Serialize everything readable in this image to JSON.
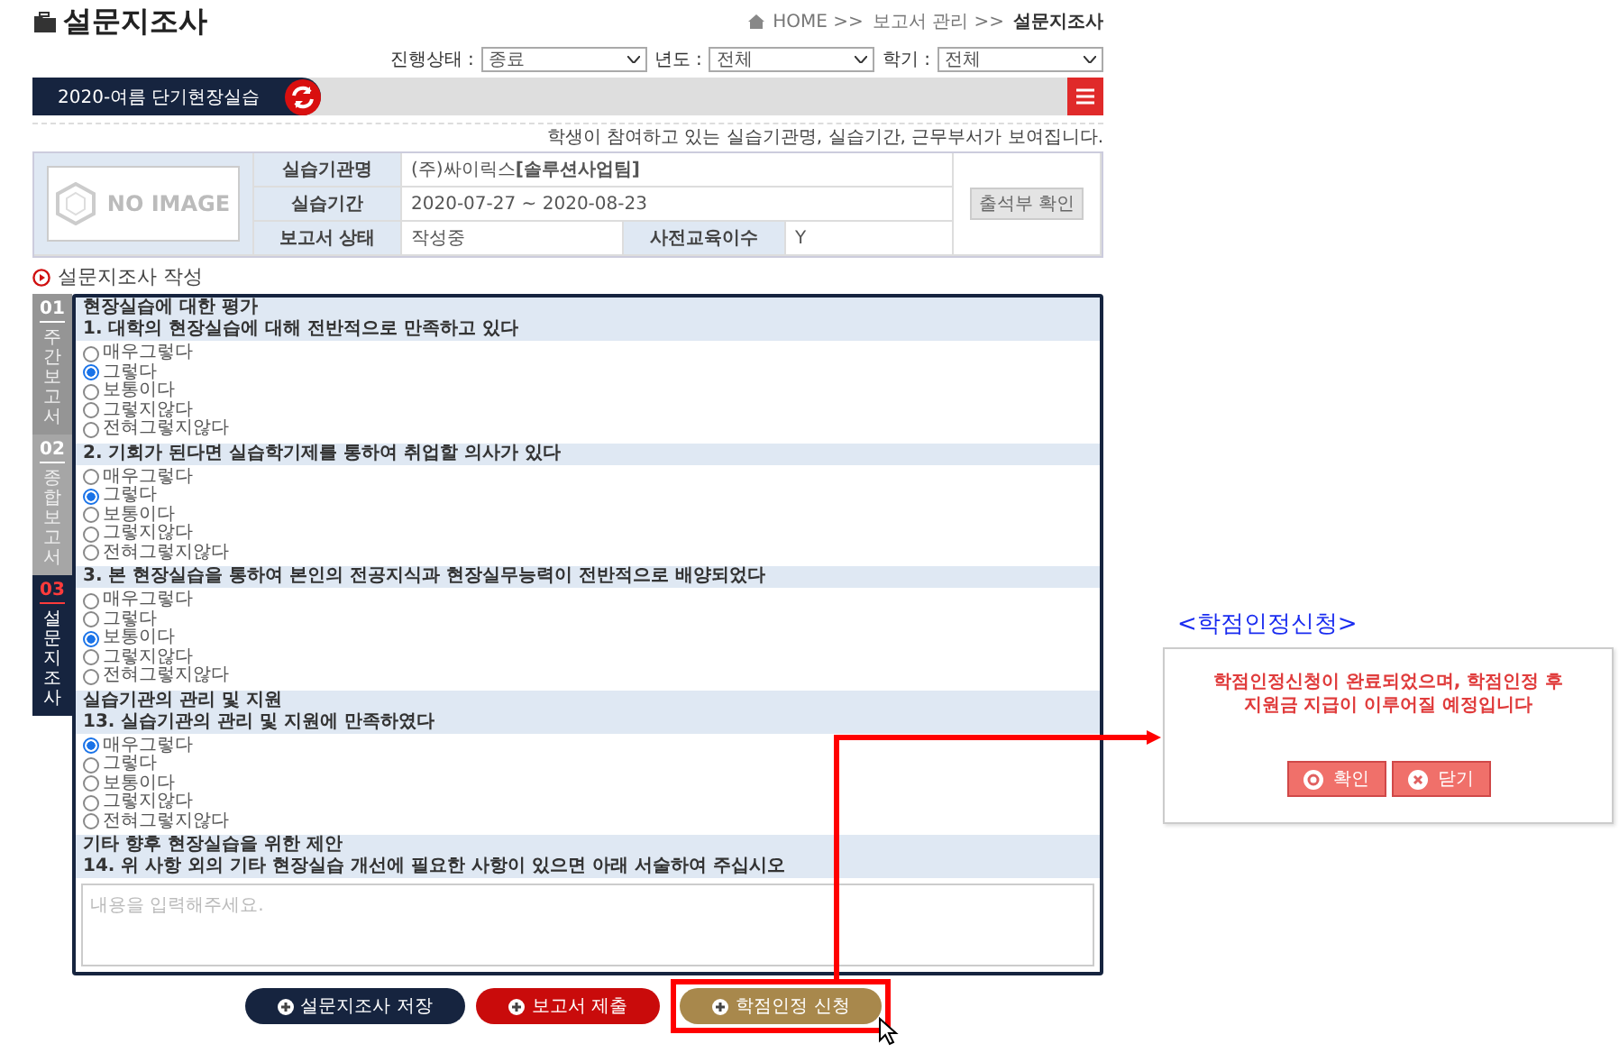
{
  "header": {
    "title": "설문지조사",
    "breadcrumb": [
      "HOME >>",
      "보고서 관리 >>",
      "설문지조사"
    ]
  },
  "filters": [
    {
      "label": "진행상태 :",
      "value": "종료"
    },
    {
      "label": "년도 :",
      "value": "전체"
    },
    {
      "label": "학기 :",
      "value": "전체"
    }
  ],
  "program_bar": {
    "label": "2020-여름 단기현장실습"
  },
  "notice": "학생이 참여하고 있는 실습기관명, 실습기간, 근무부서가 보여집니다.",
  "info_table": {
    "image_text": "NO IMAGE",
    "rows": [
      {
        "label": "실습기관명",
        "value": "(주)싸이릭스**[솔루션사업팀]**"
      },
      {
        "label": "실습기간",
        "value": "2020-07-27 ~ 2020-08-23"
      },
      {
        "label": "보고서 상태",
        "value": "작성중",
        "label_2": "사전교육이수",
        "value_2": "Y"
      }
    ],
    "button": "출석부 확인"
  },
  "section_title": "설문지조사 작성",
  "side_tabs": [
    {
      "number": "01",
      "label": "주간보고서",
      "selected": false,
      "color": "#959595"
    },
    {
      "number": "02",
      "label": "종합보고서",
      "selected": false,
      "color": "#a6a6a6"
    },
    {
      "number": "03",
      "label": "설문지조사",
      "selected": true,
      "color": "#16243f"
    }
  ],
  "survey": [
    {
      "heading": "현장실습에 대한 평가",
      "questions": [
        {
          "kind": "choice",
          "text": "1. 대학의 현장실습에 대해 전반적으로 만족하고 있다",
          "options": [
            {
              "label": "매우그렇다",
              "selected": false
            },
            {
              "label": "그렇다",
              "selected": true
            },
            {
              "label": "보통이다",
              "selected": false
            },
            {
              "label": "그렇지않다",
              "selected": false
            },
            {
              "label": "전혀그렇지않다",
              "selected": false
            }
          ]
        },
        {
          "kind": "choice",
          "text": "2. 기회가 된다면 실습학기제를 통하여 취업할 의사가 있다",
          "options": [
            {
              "label": "매우그렇다",
              "selected": false
            },
            {
              "label": "그렇다",
              "selected": true
            },
            {
              "label": "보통이다",
              "selected": false
            },
            {
              "label": "그렇지않다",
              "selected": false
            },
            {
              "label": "전혀그렇지않다",
              "selected": false
            }
          ]
        },
        {
          "kind": "choice",
          "text": "3. 본 현장실습을 통하여 본인의 전공지식과 현장실무능력이 전반적으로 배양되었다",
          "options": [
            {
              "label": "매우그렇다",
              "selected": false
            },
            {
              "label": "그렇다",
              "selected": false
            },
            {
              "label": "보통이다",
              "selected": true
            },
            {
              "label": "그렇지않다",
              "selected": false
            },
            {
              "label": "전혀그렇지않다",
              "selected": false
            }
          ]
        }
      ]
    },
    {
      "heading": "실습기관의 관리 및 지원",
      "questions": [
        {
          "kind": "choice",
          "text": "13. 실습기관의 관리 및 지원에 만족하였다",
          "options": [
            {
              "label": "매우그렇다",
              "selected": true
            },
            {
              "label": "그렇다",
              "selected": false
            },
            {
              "label": "보통이다",
              "selected": false
            },
            {
              "label": "그렇지않다",
              "selected": false
            },
            {
              "label": "전혀그렇지않다",
              "selected": false
            }
          ]
        }
      ]
    },
    {
      "heading": "기타 향후 현장실습을 위한 제안",
      "questions": [
        {
          "kind": "text",
          "text": "14. 위 사항 외의 기타 현장실습 개선에 필요한 사항이 있으면 아래 서술하여 주십시오",
          "placeholder": "내용을 입력해주세요."
        }
      ]
    }
  ],
  "buttons": [
    {
      "label": "설문지조사 저장",
      "kind": "save",
      "highlighted": false
    },
    {
      "label": "보고서 제출",
      "kind": "submit",
      "highlighted": false
    },
    {
      "label": "학점인정 신청",
      "kind": "credit",
      "highlighted": true
    }
  ],
  "popup": {
    "title": "<학점인정신청>",
    "message": "학점인정신청이 완료되었으며, 학점인정 후 지원금 지급이 이루어질 예정입니다",
    "buttons": [
      {
        "label": "확인",
        "kind": "confirm"
      },
      {
        "label": "닫기",
        "kind": "close"
      }
    ]
  }
}
